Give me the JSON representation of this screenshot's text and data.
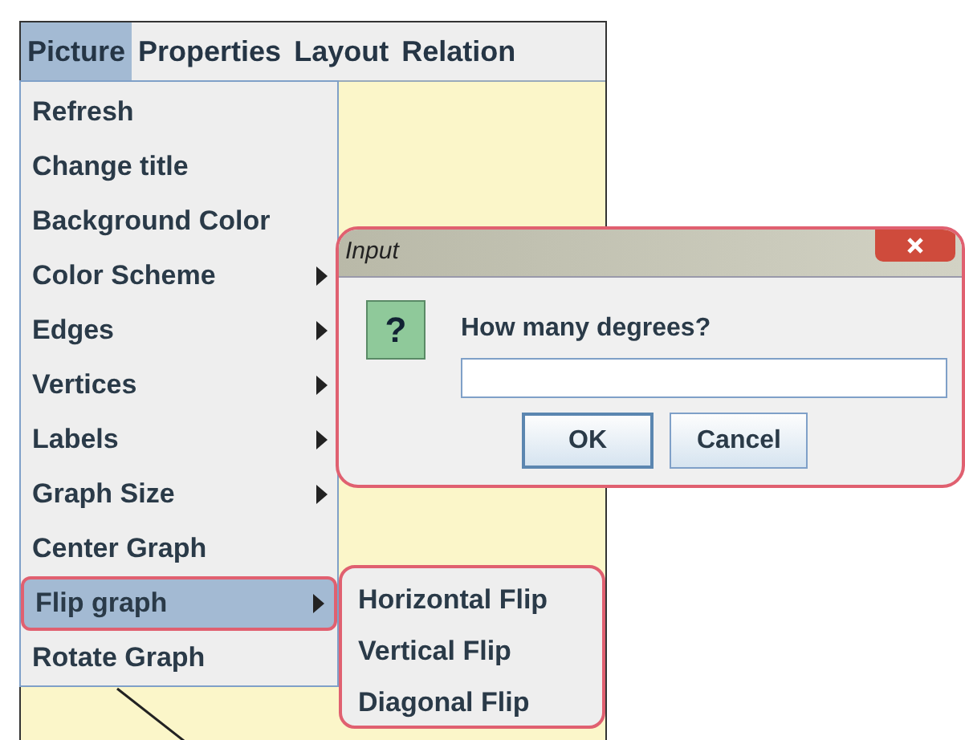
{
  "menubar": [
    {
      "label": "Picture",
      "selected": true
    },
    {
      "label": "Properties",
      "selected": false
    },
    {
      "label": "Layout",
      "selected": false
    },
    {
      "label": "Relation",
      "selected": false
    }
  ],
  "menu": [
    {
      "label": "Refresh",
      "submenu": false,
      "selected": false
    },
    {
      "label": "Change title",
      "submenu": false,
      "selected": false
    },
    {
      "label": "Background Color",
      "submenu": false,
      "selected": false
    },
    {
      "label": "Color Scheme",
      "submenu": true,
      "selected": false
    },
    {
      "label": "Edges",
      "submenu": true,
      "selected": false
    },
    {
      "label": "Vertices",
      "submenu": true,
      "selected": false
    },
    {
      "label": "Labels",
      "submenu": true,
      "selected": false
    },
    {
      "label": "Graph Size",
      "submenu": true,
      "selected": false
    },
    {
      "label": "Center Graph",
      "submenu": false,
      "selected": false
    },
    {
      "label": "Flip graph",
      "submenu": true,
      "selected": true
    },
    {
      "label": "Rotate Graph",
      "submenu": false,
      "selected": false
    }
  ],
  "submenu": [
    "Horizontal Flip",
    "Vertical Flip",
    "Diagonal Flip"
  ],
  "dialog": {
    "title": "Input",
    "message": "How many degrees?",
    "icon": "?",
    "buttons": [
      "OK",
      "Cancel"
    ]
  }
}
